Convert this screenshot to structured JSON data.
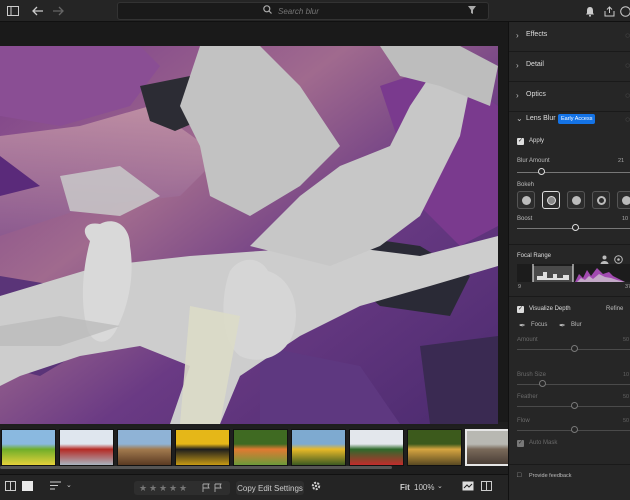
{
  "topbar": {
    "search_placeholder": "Search blur",
    "icons": [
      "sidebar-toggle-icon",
      "back-arrow-icon",
      "forward-arrow-icon",
      "search-icon",
      "filter-icon",
      "bell-icon",
      "share-icon",
      "help-icon"
    ]
  },
  "panel": {
    "effects_label": "Effects",
    "detail_label": "Detail",
    "optics_label": "Optics",
    "lensblur_label": "Lens Blur",
    "early_access": "Early Access",
    "apply_label": "Apply",
    "blur_amount_label": "Blur Amount",
    "blur_amount_value": "21",
    "bokeh_label": "Bokeh",
    "boost_label": "Boost",
    "boost_value": "10",
    "focal_range_label": "Focal Range",
    "focal_min": "9",
    "focal_max": "37",
    "visualize_depth_label": "Visualize Depth",
    "refine_label": "Refine",
    "focus_label": "Focus",
    "blur_label": "Blur",
    "amount_label": "Amount",
    "amount_value": "50",
    "brush_size_label": "Brush Size",
    "brush_size_value": "10",
    "feather_label": "Feather",
    "feather_value": "50",
    "flow_label": "Flow",
    "flow_value": "50",
    "auto_mask_label": "Auto Mask",
    "feedback_label": "Provide feedback",
    "blur_amount_fraction": 0.21,
    "boost_fraction": 0.5
  },
  "bottombar": {
    "copy_edit_label": "Copy Edit Settings",
    "fit_label": "Fit",
    "zoom_value": "100%"
  },
  "filmstrip": {
    "thumbnails": [
      {
        "name": "thumb-field-kids",
        "colors": [
          "#8ab9e0",
          "#6fae2a",
          "#e6d23a"
        ]
      },
      {
        "name": "thumb-winter-barn",
        "colors": [
          "#dfe6ee",
          "#b52a24",
          "#aab4bf"
        ]
      },
      {
        "name": "thumb-desert-car",
        "colors": [
          "#8fb3d6",
          "#a27a4e",
          "#5a3a22"
        ]
      },
      {
        "name": "thumb-yellow-machine",
        "colors": [
          "#e5b718",
          "#1e1e1e",
          "#c79a14"
        ]
      },
      {
        "name": "thumb-garden-people",
        "colors": [
          "#3f6a22",
          "#e07a31",
          "#6c9a3a"
        ]
      },
      {
        "name": "thumb-sunflowers",
        "colors": [
          "#7eaad0",
          "#e8b928",
          "#3c5a22"
        ]
      },
      {
        "name": "thumb-christmas-tree",
        "colors": [
          "#e3e7ec",
          "#2e6a2c",
          "#c22c2c"
        ]
      },
      {
        "name": "thumb-forest-path",
        "colors": [
          "#3c5a1c",
          "#d6a540",
          "#5a4a22"
        ]
      },
      {
        "name": "thumb-owl-branch",
        "colors": [
          "#b8b8b2",
          "#7a6a5a",
          "#4a3e36"
        ]
      }
    ],
    "selected_index": 8
  }
}
